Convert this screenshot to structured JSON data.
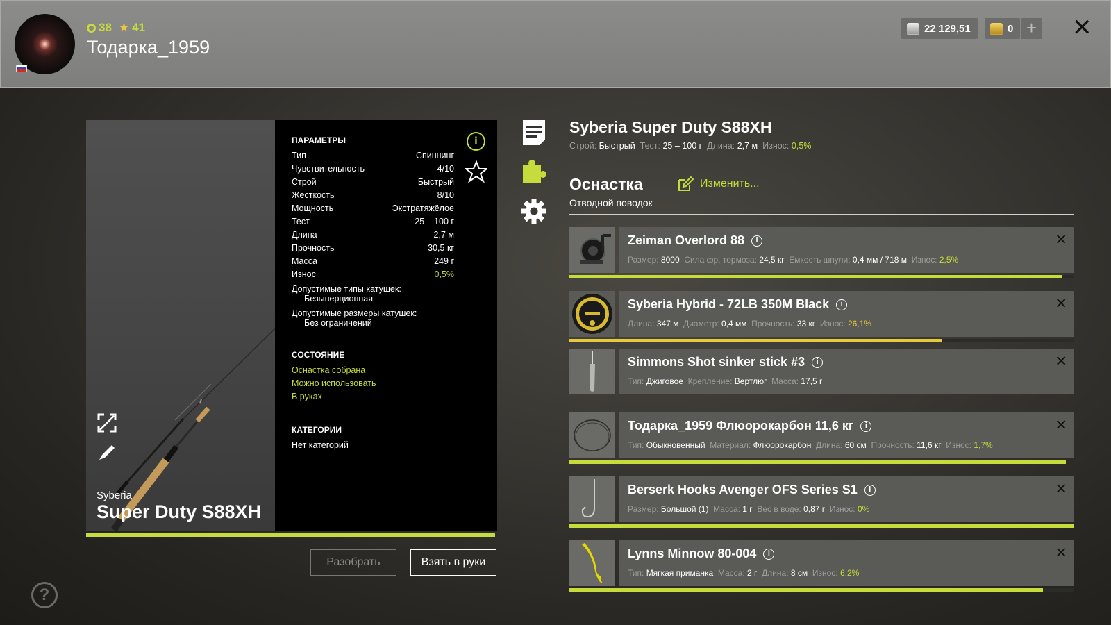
{
  "player": {
    "level": "38",
    "rank": "41",
    "name": "Тодарка_1959"
  },
  "currency": {
    "silver": "22 129,51",
    "gold": "0",
    "plus": "+"
  },
  "rod": {
    "brand": "Syberia",
    "model": "Super Duty S88XH",
    "condition": 0.995
  },
  "params": {
    "title": "ПАРАМЕТРЫ",
    "rows": [
      {
        "label": "Тип",
        "value": "Спиннинг"
      },
      {
        "label": "Чувствительность",
        "value": "4/10"
      },
      {
        "label": "Строй",
        "value": "Быстрый"
      },
      {
        "label": "Жёсткость",
        "value": "8/10"
      },
      {
        "label": "Мощность",
        "value": "Экстратяжёлое"
      },
      {
        "label": "Тест",
        "value": "25 – 100 г"
      },
      {
        "label": "Длина",
        "value": "2,7 м"
      },
      {
        "label": "Прочность",
        "value": "30,5 кг"
      },
      {
        "label": "Масса",
        "value": "249 г"
      },
      {
        "label": "Износ",
        "value": "0,5%"
      }
    ],
    "reel_types_label": "Допустимые типы катушек:",
    "reel_types_value": "Безынерционная",
    "reel_sizes_label": "Допустимые размеры катушек:",
    "reel_sizes_value": "Без ограничений",
    "state_title": "СОСТОЯНИЕ",
    "states": [
      "Оснастка собрана",
      "Можно использовать",
      "В руках"
    ],
    "categories_title": "КАТЕГОРИИ",
    "categories_value": "Нет категорий",
    "info_glyph": "i"
  },
  "buttons": {
    "disassemble": "Разобрать",
    "take": "Взять в руки",
    "help": "?",
    "close": "✕"
  },
  "detail": {
    "title": "Syberia Super Duty S88XH",
    "action_label": "Строй:",
    "action_value": "Быстрый",
    "test_label": "Тест:",
    "test_value": "25 – 100 г",
    "length_label": "Длина:",
    "length_value": "2,7 м",
    "wear_label": "Износ:",
    "wear_value": "0,5%",
    "tackle_title": "Оснастка",
    "tackle_sub": "Отводной поводок",
    "change": "Изменить..."
  },
  "items": [
    {
      "name": "Zeiman Overlord 88",
      "thumb": "reel-icon",
      "specs": [
        {
          "l": "Размер:",
          "v": "8000"
        },
        {
          "l": "Сила фр. тормоза:",
          "v": "24,5 кг"
        },
        {
          "l": "Ёмкость шпули:",
          "v": "0,4 мм / 718 м"
        },
        {
          "l": "Износ:",
          "v": "2,5%",
          "c": "grn"
        }
      ],
      "condition": 0.975,
      "bar_color": "#c6db3c"
    },
    {
      "name": "Syberia Hybrid - 72LB 350M Black",
      "thumb": "line-spool-icon",
      "specs": [
        {
          "l": "Длина:",
          "v": "347 м"
        },
        {
          "l": "Диаметр:",
          "v": "0,4 мм"
        },
        {
          "l": "Прочность:",
          "v": "33 кг"
        },
        {
          "l": "Износ:",
          "v": "26,1%",
          "c": "yel"
        }
      ],
      "condition": 0.739,
      "bar_color": "#e8c93c"
    },
    {
      "name": "Simmons Shot sinker stick #3",
      "thumb": "sinker-icon",
      "specs": [
        {
          "l": "Тип:",
          "v": "Джиговое"
        },
        {
          "l": "Крепление:",
          "v": "Вертлюг"
        },
        {
          "l": "Масса:",
          "v": "17,5 г"
        }
      ],
      "condition": null,
      "bar_color": null
    },
    {
      "name": "Тодарка_1959 Флюорокарбон 11,6 кг",
      "thumb": "leader-icon",
      "specs": [
        {
          "l": "Тип:",
          "v": "Обыкновенный"
        },
        {
          "l": "Материал:",
          "v": "Флюорокарбон"
        },
        {
          "l": "Длина:",
          "v": "60 см"
        },
        {
          "l": "Прочность:",
          "v": "11,6 кг"
        },
        {
          "l": "Износ:",
          "v": "1,7%",
          "c": "grn"
        }
      ],
      "condition": 0.983,
      "bar_color": "#c6db3c"
    },
    {
      "name": "Berserk Hooks Avenger OFS Series S1",
      "thumb": "hook-icon",
      "specs": [
        {
          "l": "Размер:",
          "v": "Большой (1)"
        },
        {
          "l": "Масса:",
          "v": "1 г"
        },
        {
          "l": "Вес в воде:",
          "v": "0,87 г"
        },
        {
          "l": "Износ:",
          "v": "0%",
          "c": "grn"
        }
      ],
      "condition": 1.0,
      "bar_color": "#c6db3c"
    },
    {
      "name": "Lynns Minnow 80-004",
      "thumb": "soft-bait-icon",
      "specs": [
        {
          "l": "Тип:",
          "v": "Мягкая приманка"
        },
        {
          "l": "Масса:",
          "v": "2 г"
        },
        {
          "l": "Длина:",
          "v": "8 см"
        },
        {
          "l": "Износ:",
          "v": "6,2%",
          "c": "grn"
        }
      ],
      "condition": 0.938,
      "bar_color": "#c6db3c"
    }
  ]
}
